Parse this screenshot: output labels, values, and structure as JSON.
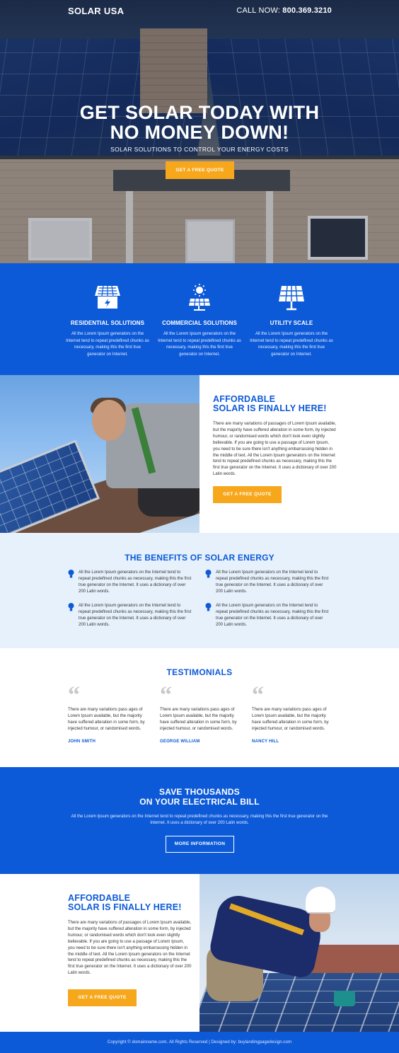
{
  "header": {
    "logo": "SOLAR USA",
    "call_label": "CALL NOW:",
    "phone": "800.369.3210"
  },
  "hero": {
    "title_line1": "GET SOLAR TODAY WITH",
    "title_line2": "NO MONEY DOWN!",
    "subtitle": "SOLAR SOLUTIONS TO CONTROL YOUR ENERGY COSTS",
    "cta": "GET A FREE QUOTE"
  },
  "services": [
    {
      "icon": "house-solar-icon",
      "title": "RESIDENTIAL SOLUTIONS",
      "desc": "All the Lorem Ipsum generators on the Internet tend to repeat predefined chunks as necessary, making this the first true generator on Internet."
    },
    {
      "icon": "sun-panel-icon",
      "title": "COMMERCIAL SOLUTIONS",
      "desc": "All the Lorem Ipsum generators on the Internet tend to repeat predefined chunks as necessary, making this the first true generator on Internet."
    },
    {
      "icon": "solar-panel-icon",
      "title": "UTILITY SCALE",
      "desc": "All the Lorem Ipsum generators on the Internet tend to repeat predefined chunks as necessary, making this the first true generator on Internet."
    }
  ],
  "affordable1": {
    "title_line1": "AFFORDABLE",
    "title_line2": "SOLAR IS FINALLY HERE!",
    "body": "There are many variations of passages of Lorem Ipsum available, but the majority have suffered alteration in some form, by injected humour, or randomised words which don't look even slightly believable. If you are going to use a passage of Lorem Ipsum, you need to be sure there isn't anything embarrassing hidden in the middle of text. All the Lorem Ipsum generators on the Internet tend to repeat predefined chunks as necessary, making this the first true generator on the Internet. It uses a dictionary of over 200 Latin words.",
    "cta": "GET A FREE QUOTE"
  },
  "benefits": {
    "title": "THE BENEFITS OF SOLAR ENERGY",
    "items": [
      "All the Lorem Ipsum generators on the Internet tend to repeat predefined chunks as necessary, making this the first true generator on the Internet. It uses a dictionary of over 200 Latin words.",
      "All the Lorem Ipsum generators on the Internet tend to repeat predefined chunks as necessary, making this the first true generator on the Internet. It uses a dictionary of over 200 Latin words.",
      "All the Lorem Ipsum generators on the Internet tend to repeat predefined chunks as necessary, making this the first true generator on the Internet. It uses a dictionary of over 200 Latin words.",
      "All the Lorem Ipsum generators on the Internet tend to repeat predefined chunks as necessary, making this the first true generator on the Internet. It uses a dictionary of over 200 Latin words."
    ]
  },
  "testimonials": {
    "title": "TESTIMONIALS",
    "items": [
      {
        "text": "There are many variations pass ages of Lorem Ipsum available, but the majority have suffered alteration in some form, by injected humour, or randomised words.",
        "name": "JOHN SMITH"
      },
      {
        "text": "There are many variations pass ages of Lorem Ipsum available, but the majority have suffered alteration in some form, by injected humour, or randomised words.",
        "name": "GEORGE WILLIAM"
      },
      {
        "text": "There are many variations pass ages of Lorem Ipsum available, but the majority have suffered alteration in some form, by injected humour, or randomised words.",
        "name": "NANCY HILL"
      }
    ]
  },
  "save": {
    "title_line1": "SAVE THOUSANDS",
    "title_line2": "ON YOUR ELECTRICAL BILL",
    "body": "All the Lorem Ipsum generators on the Internet tend to repeat predefined chunks as necessary, making this the first true generator on the Internet. It uses a dictionary of over 200 Latin words.",
    "cta": "MORE INFORMATION"
  },
  "affordable2": {
    "title_line1": "AFFORDABLE",
    "title_line2": "SOLAR IS FINALLY HERE!",
    "body": "There are many variations of passages of Lorem Ipsum available, but the majority have suffered alteration in some form, by injected humour, or randomised words which don't look even slightly believable. If you are going to use a passage of Lorem Ipsum, you need to be sure there isn't anything embarrassing hidden in the middle of text. All the Lorem Ipsum generators on the Internet tend to repeat predefined chunks as necessary, making this the first true generator on the Internet. It uses a dictionary of over 200 Latin words.",
    "cta": "GET A FREE QUOTE"
  },
  "footer": {
    "text": "Copyright © domainname.com. All Rights Reserved  |  Designed by: buylandingpagedesign.com"
  },
  "colors": {
    "brand_blue": "#0d5ad8",
    "accent_orange": "#f7a71b",
    "benefits_bg": "#e7f1fc"
  }
}
